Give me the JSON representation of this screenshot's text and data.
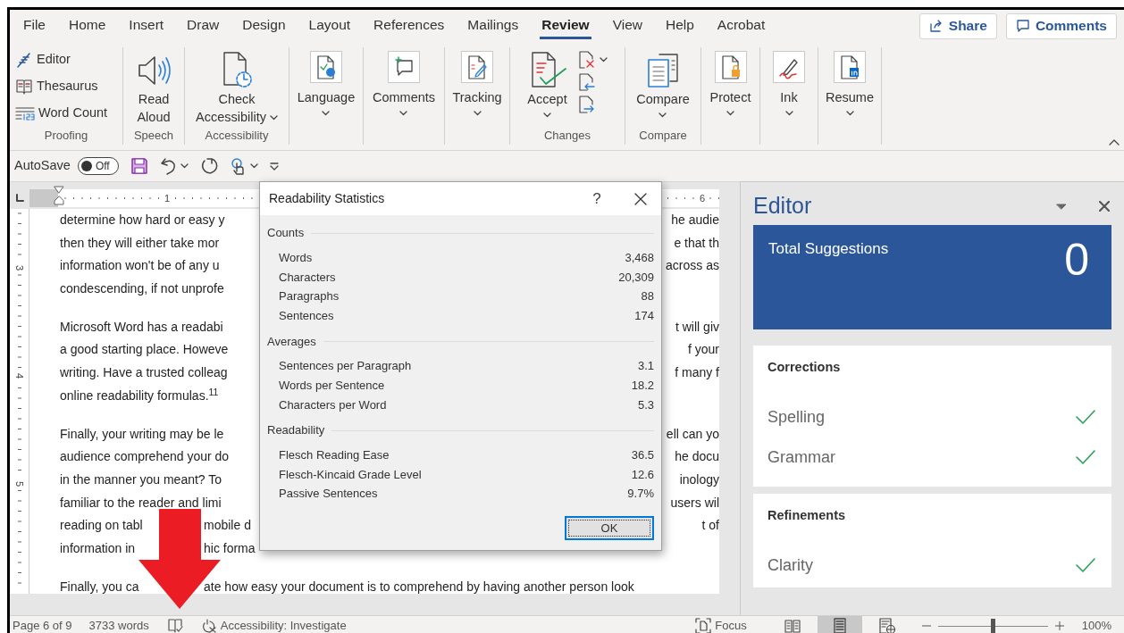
{
  "tabs": [
    {
      "label": "File",
      "selected": false
    },
    {
      "label": "Home",
      "selected": false
    },
    {
      "label": "Insert",
      "selected": false
    },
    {
      "label": "Draw",
      "selected": false
    },
    {
      "label": "Design",
      "selected": false
    },
    {
      "label": "Layout",
      "selected": false
    },
    {
      "label": "References",
      "selected": false
    },
    {
      "label": "Mailings",
      "selected": false
    },
    {
      "label": "Review",
      "selected": true
    },
    {
      "label": "View",
      "selected": false
    },
    {
      "label": "Help",
      "selected": false
    },
    {
      "label": "Acrobat",
      "selected": false
    }
  ],
  "header_buttons": [
    {
      "label": "Share"
    },
    {
      "label": "Comments"
    }
  ],
  "ribbon_groups": [
    {
      "label": "Proofing",
      "kind": "stack",
      "items": [
        {
          "label": "Editor"
        },
        {
          "label": "Thesaurus"
        },
        {
          "label": "Word Count"
        }
      ]
    },
    {
      "label": "Speech",
      "kind": "large",
      "items": [
        {
          "label": "Read Aloud",
          "dropdown": false
        }
      ]
    },
    {
      "label": "Accessibility",
      "kind": "large",
      "items": [
        {
          "label": "Check Accessibility",
          "dropdown": true
        }
      ]
    },
    {
      "kind": "boxed",
      "items": [
        {
          "label": "Language",
          "dropdown": true
        }
      ]
    },
    {
      "kind": "boxed",
      "items": [
        {
          "label": "Comments",
          "dropdown": true
        }
      ]
    },
    {
      "kind": "boxed",
      "items": [
        {
          "label": "Tracking",
          "dropdown": true
        }
      ]
    },
    {
      "label": "Changes",
      "kind": "accept",
      "items": [
        {
          "label": "Accept",
          "dropdown": true
        }
      ]
    },
    {
      "label": "Compare",
      "kind": "large",
      "items": [
        {
          "label": "Compare",
          "dropdown": true
        }
      ]
    },
    {
      "kind": "boxed",
      "items": [
        {
          "label": "Protect",
          "dropdown": true
        }
      ]
    },
    {
      "kind": "boxed",
      "items": [
        {
          "label": "Ink",
          "dropdown": true
        }
      ]
    },
    {
      "kind": "boxed",
      "items": [
        {
          "label": "Resume",
          "dropdown": true
        }
      ]
    }
  ],
  "quick_access": {
    "autosave_label": "AutoSave",
    "toggle_text": "Off",
    "on": false
  },
  "ruler": {
    "horizontal": [
      "1",
      "6"
    ],
    "vertical": [
      "3",
      "4",
      "5"
    ]
  },
  "document": [
    [
      {
        "segments": [
          "determine how hard or easy y"
        ],
        "right": "he audie"
      },
      {
        "segments": [
          "then they will either take mor"
        ],
        "right": "e that th"
      },
      {
        "segments": [
          "information won't be of any u"
        ],
        "right": "across as"
      },
      {
        "segments": [
          "condescending, if not unprofe"
        ]
      }
    ],
    [
      {
        "segments": [
          "Microsoft Word has a readabi"
        ],
        "right": "t will giv"
      },
      {
        "segments": [
          "a good starting place. Howeve"
        ],
        "right": "f your"
      },
      {
        "segments": [
          "writing. Have a trusted colleag"
        ],
        "right": "f many f"
      },
      {
        "segments": [
          "online readability formulas.$^{11}$"
        ]
      }
    ],
    [
      {
        "segments": [
          "Finally, your writing may be le"
        ],
        "right": "ell can yo"
      },
      {
        "segments": [
          "audience comprehend your do"
        ],
        "right": "he docu"
      },
      {
        "segments": [
          "in the manner you meant? To"
        ],
        "right": "inology"
      },
      {
        "segments": [
          "familiar to the reader and limi"
        ],
        "right": "users wil"
      },
      {
        "segments": [
          "reading on tabl",
          "mobile d"
        ],
        "right": "t of"
      },
      {
        "segments": [
          "information in",
          "hic forma"
        ]
      }
    ],
    [
      {
        "segments": [
          "Finally, you ca",
          "ate how easy your document is to comprehend by having another person look"
        ]
      }
    ]
  ],
  "dialog": {
    "title": "Readability Statistics",
    "help": "?",
    "sections": [
      {
        "title": "Counts",
        "rows": [
          [
            "Words",
            "3,468"
          ],
          [
            "Characters",
            "20,309"
          ],
          [
            "Paragraphs",
            "88"
          ],
          [
            "Sentences",
            "174"
          ]
        ]
      },
      {
        "title": "Averages",
        "rows": [
          [
            "Sentences per Paragraph",
            "3.1"
          ],
          [
            "Words per Sentence",
            "18.2"
          ],
          [
            "Characters per Word",
            "5.3"
          ]
        ]
      },
      {
        "title": "Readability",
        "rows": [
          [
            "Flesch Reading Ease",
            "36.5"
          ],
          [
            "Flesch-Kincaid Grade Level",
            "12.6"
          ],
          [
            "Passive Sentences",
            "9.7%"
          ]
        ]
      }
    ],
    "ok": "OK"
  },
  "editor_pane": {
    "title": "Editor",
    "total_label": "Total Suggestions",
    "total_count": "0",
    "sections": [
      {
        "title": "Corrections",
        "items": [
          {
            "label": "Spelling",
            "done": true
          },
          {
            "label": "Grammar",
            "done": true
          }
        ]
      },
      {
        "title": "Refinements",
        "items": [
          {
            "label": "Clarity",
            "done": true
          }
        ]
      }
    ]
  },
  "status_bar": {
    "page": "Page 6 of 9",
    "words": "3733 words",
    "accessibility": "Accessibility: Investigate",
    "focus": "Focus",
    "views": [
      {
        "selected": false
      },
      {
        "selected": true
      },
      {
        "selected": false
      }
    ],
    "zoom": {
      "level": 0.5,
      "label": "100%"
    }
  }
}
